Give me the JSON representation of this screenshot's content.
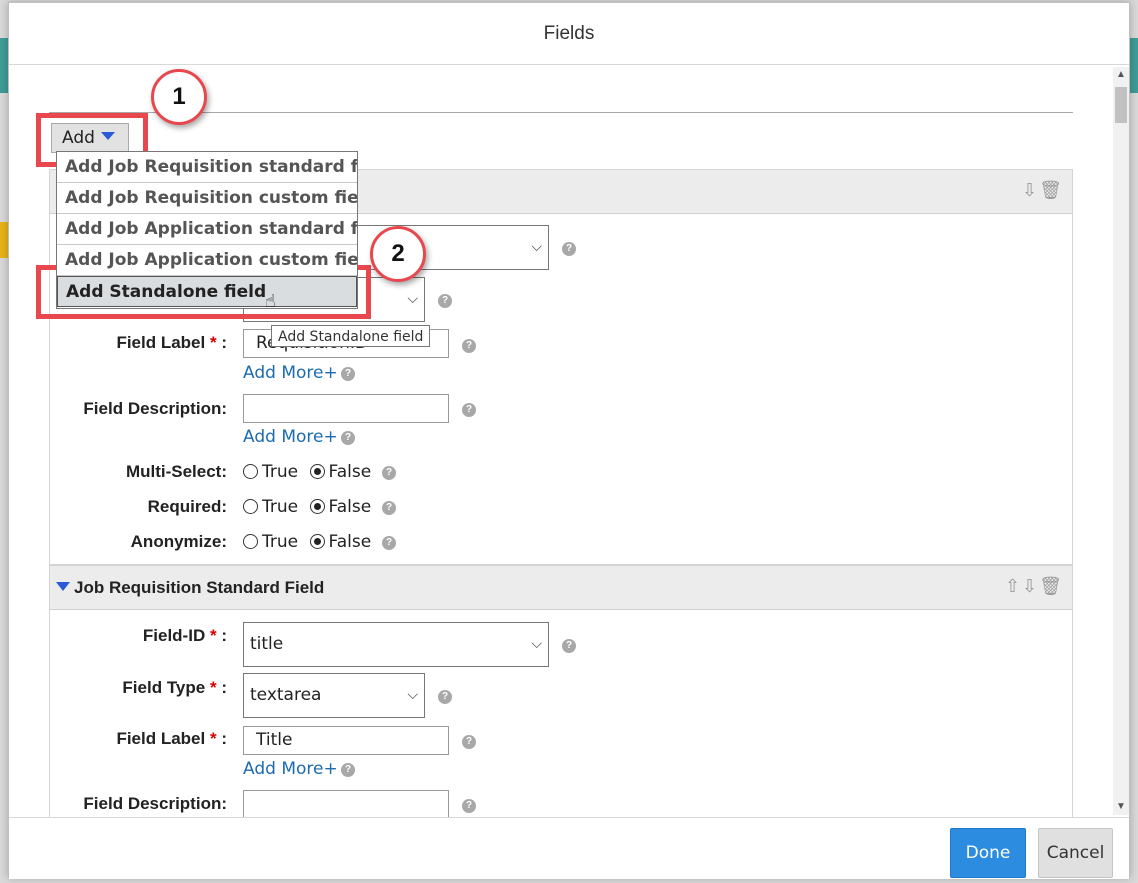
{
  "dialog": {
    "title": "Fields",
    "done_label": "Done",
    "cancel_label": "Cancel"
  },
  "add_button": {
    "label": "Add"
  },
  "annotations": {
    "step1": "1",
    "step2": "2",
    "color": "#e8474d"
  },
  "add_menu": {
    "items": [
      "Add Job Requisition standard field",
      "Add Job Requisition custom field",
      "Add Job Application standard field",
      "Add Job Application custom field",
      "Add Standalone field"
    ],
    "active_index": 4
  },
  "tooltip": "Add Standalone field",
  "field1": {
    "field_label_label": "Field Label",
    "field_label_value": "RequisitionID",
    "add_more": "Add More+",
    "field_description_label": "Field Description:",
    "field_description_value": "",
    "add_more_2": "Add More+",
    "multi_select_label": "Multi-Select:",
    "required_label": "Required:",
    "anonymize_label": "Anonymize:",
    "true_label": "True",
    "false_label": "False",
    "multi_select_value": "False",
    "required_value": "False",
    "anonymize_value": "False"
  },
  "field2": {
    "section_title": "Job Requisition Standard Field",
    "field_id_label": "Field-ID",
    "field_id_value": "title",
    "field_type_label": "Field Type",
    "field_type_value": "textarea",
    "field_label_label": "Field Label",
    "field_label_value": "Title",
    "add_more": "Add More+",
    "field_description_label": "Field Description:"
  },
  "required_marker": "*",
  "colon": ":",
  "colors": {
    "accent": "#2b8ce0",
    "link": "#1c6bb0",
    "required": "#d60000"
  }
}
